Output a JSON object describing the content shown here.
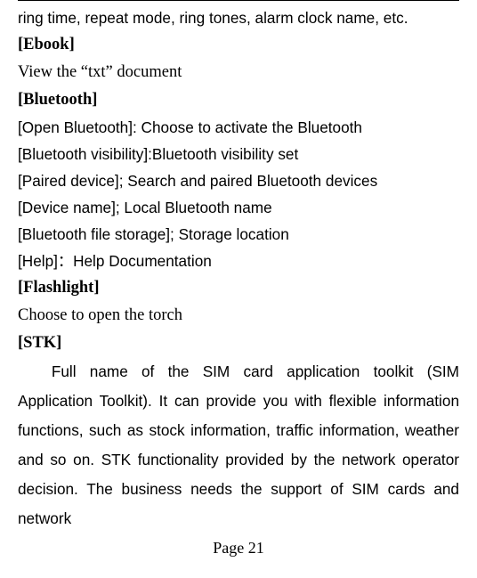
{
  "top_fragment": "ring time, repeat mode, ring tones, alarm clock name, etc.",
  "ebook": {
    "heading": "[Ebook]",
    "desc": "View the “txt” document"
  },
  "bluetooth": {
    "heading": "[Bluetooth]",
    "items": [
      "[Open Bluetooth]: Choose to activate the Bluetooth",
      "[Bluetooth visibility]:Bluetooth visibility set",
      "[Paired device]; Search and paired Bluetooth devices",
      "[Device name]; Local Bluetooth name",
      "[Bluetooth file storage]; Storage location",
      "[Help]：Help Documentation"
    ]
  },
  "flashlight": {
    "heading": "[Flashlight]",
    "desc": "Choose to open the torch"
  },
  "stk": {
    "heading": "[STK]",
    "para": "Full name of the SIM card application toolkit (SIM Application Toolkit). It can provide you with flexible information functions, such as stock information, traffic information, weather and so on. STK functionality provided by the network operator decision. The business needs the support of SIM cards and network"
  },
  "footer": "Page 21"
}
